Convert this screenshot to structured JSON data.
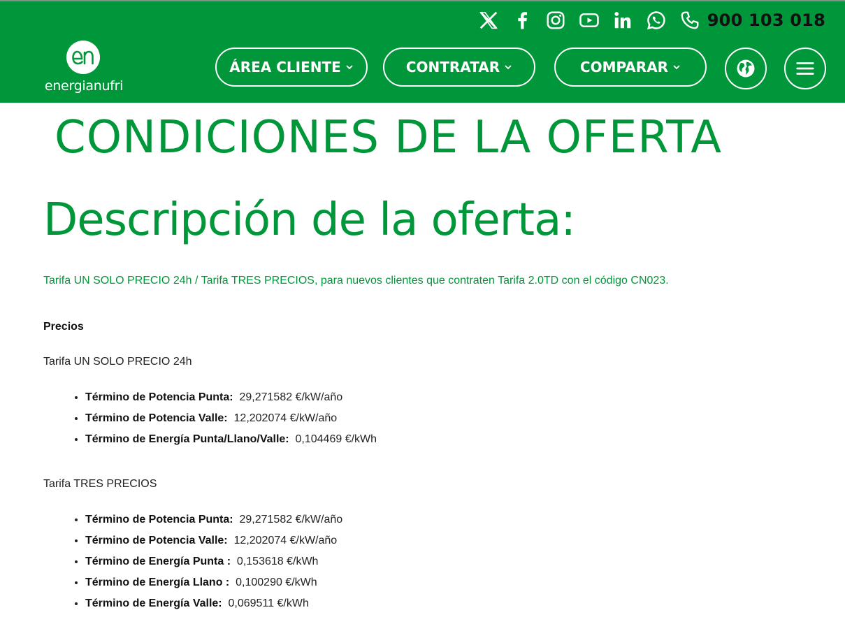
{
  "header": {
    "phone": "900 103 018",
    "logo_text": "energianufri",
    "nav": [
      {
        "label": "ÁREA CLIENTE"
      },
      {
        "label": "CONTRATAR"
      },
      {
        "label": "COMPARAR"
      }
    ],
    "social_icons": [
      "x-icon",
      "facebook-icon",
      "instagram-icon",
      "youtube-icon",
      "linkedin-icon",
      "whatsapp-icon",
      "phone-icon"
    ]
  },
  "page": {
    "title": "CONDICIONES DE LA OFERTA",
    "subtitle": "Descripción de la oferta:",
    "intro": "Tarifa UN SOLO PRECIO 24h / Tarifa TRES PRECIOS,  para nuevos clientes que contraten Tarifa 2.0TD  con el código CN023.",
    "prices_label": "Precios",
    "tarifa1": {
      "title": "Tarifa UN SOLO PRECIO 24h",
      "items": [
        {
          "label": "Término de Potencia Punta:",
          "value": "29,271582 €/kW/año"
        },
        {
          "label": "Término de Potencia Valle:",
          "value": "12,202074 €/kW/año"
        },
        {
          "label": "Término de Energía Punta/Llano/Valle:",
          "value": "0,104469 €/kWh"
        }
      ]
    },
    "tarifa2": {
      "title": "Tarifa TRES PRECIOS",
      "items": [
        {
          "label": "Término de Potencia Punta:",
          "value": "29,271582 €/kW/año"
        },
        {
          "label": "Término de Potencia Valle:",
          "value": "12,202074 €/kW/año"
        },
        {
          "label": "Término de Energía Punta :",
          "value": "0,153618 €/kWh"
        },
        {
          "label": "Término de Energía Llano :",
          "value": "0,100290 €/kWh"
        },
        {
          "label": "Término de Energía Valle:",
          "value": "0,069511 €/kWh"
        }
      ]
    }
  },
  "colors": {
    "brand_green": "#00973a",
    "white": "#ffffff",
    "text": "#222222"
  }
}
